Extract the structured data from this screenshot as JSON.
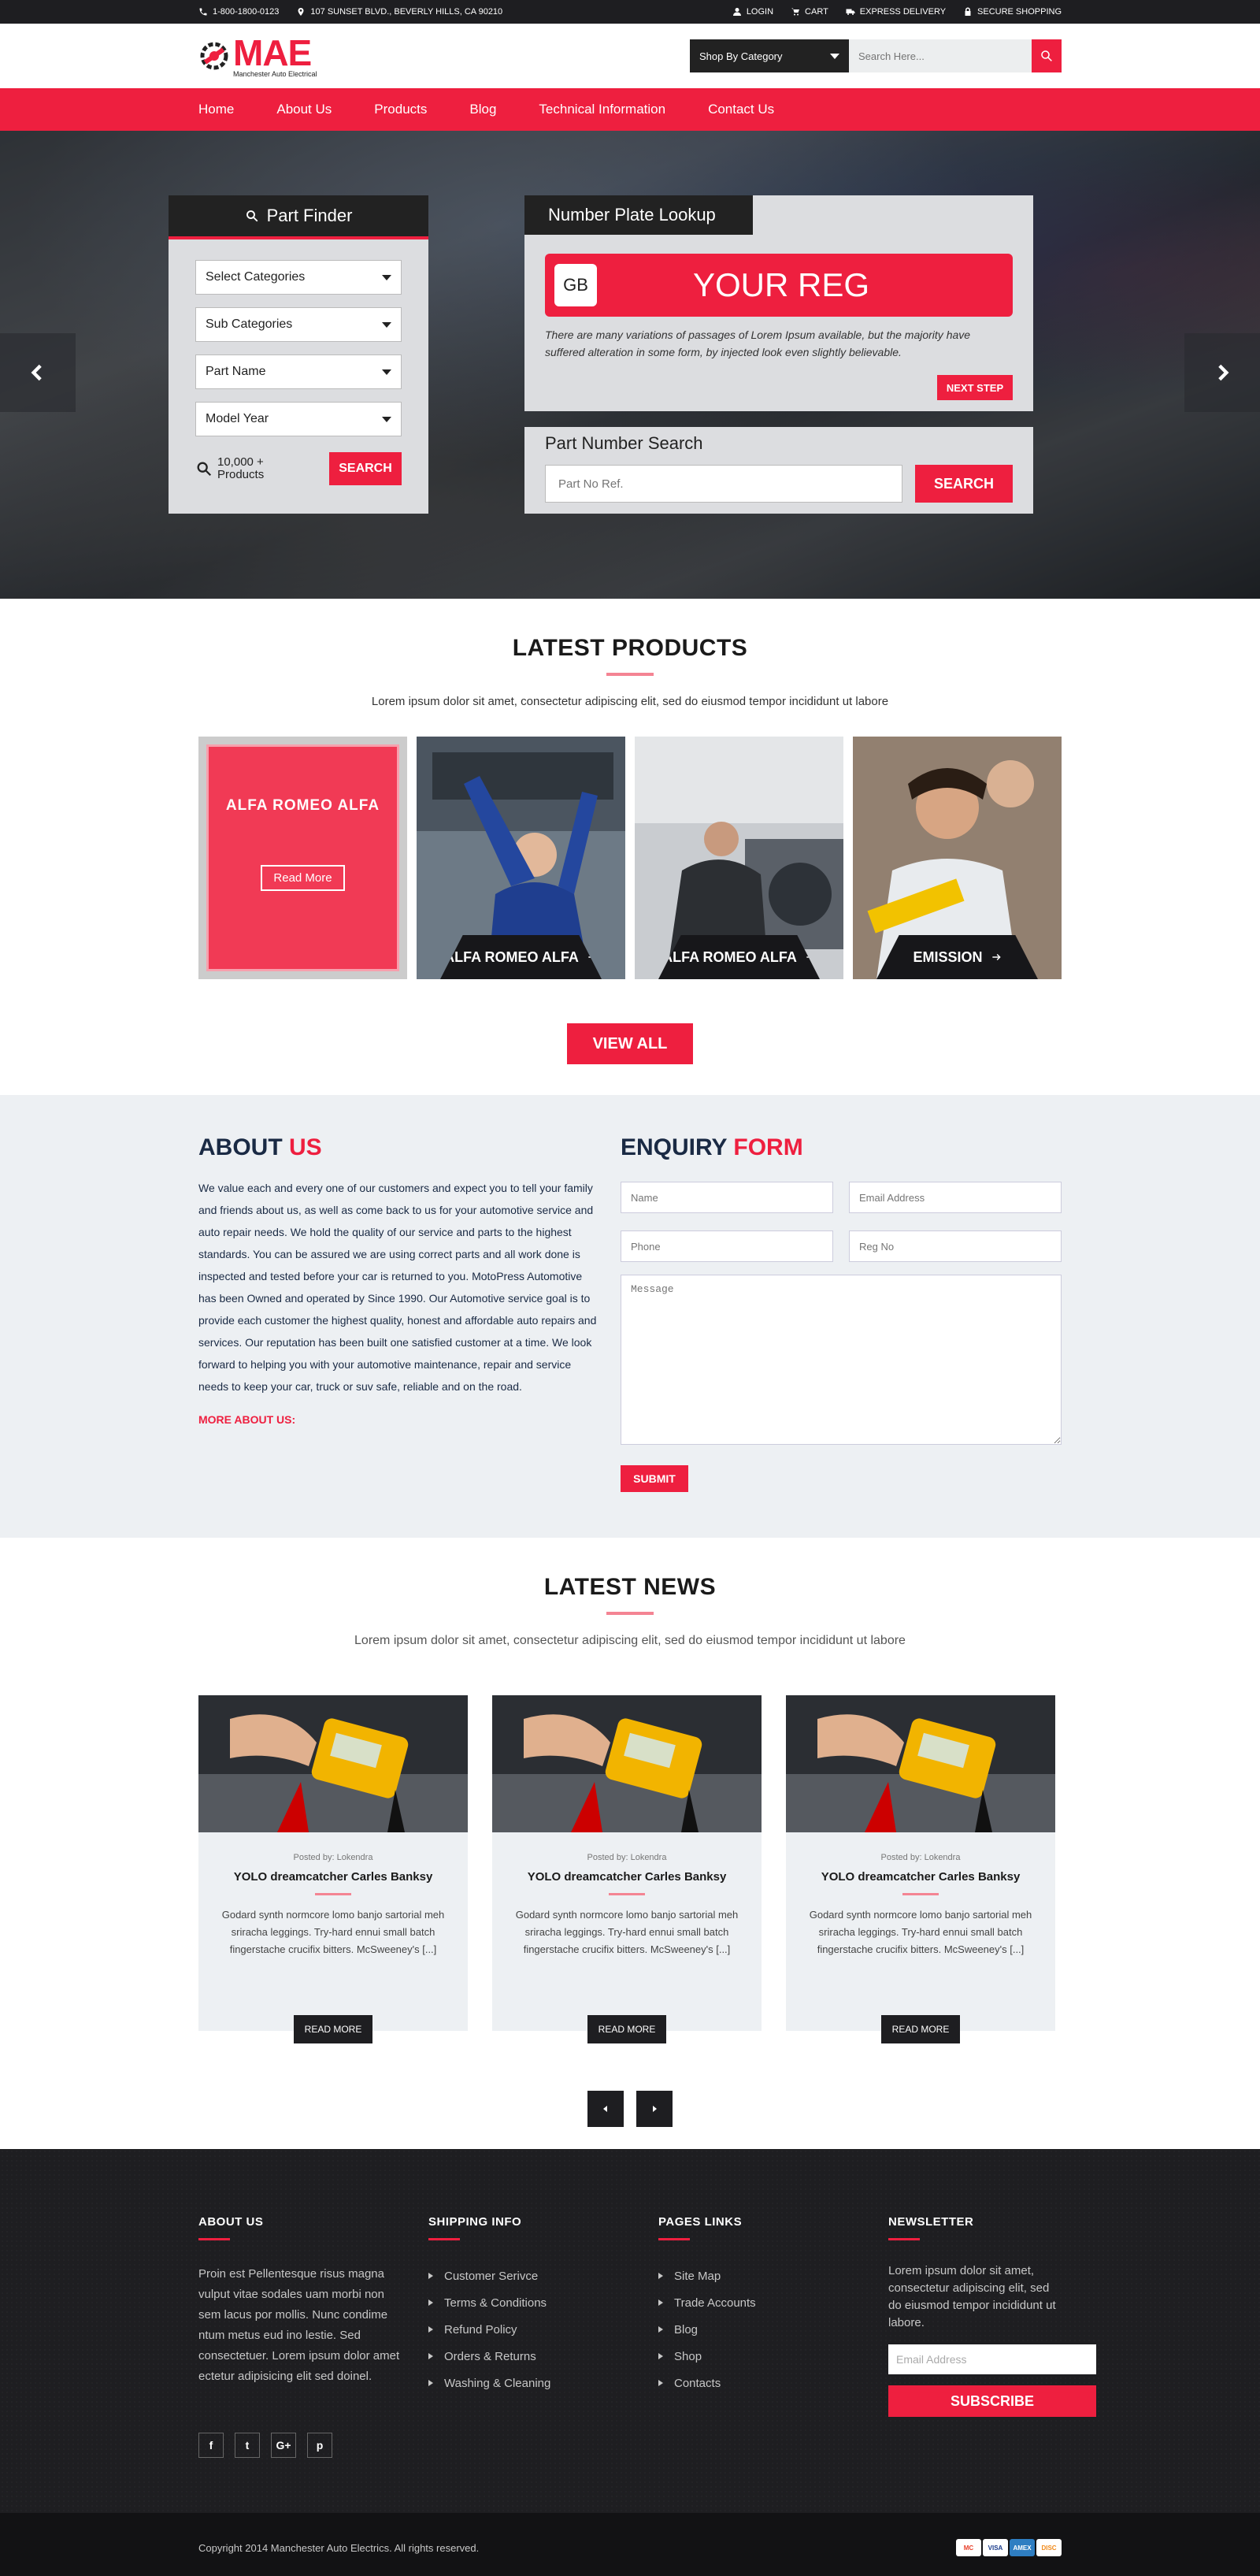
{
  "topbar": {
    "phone": "1-800-1800-0123",
    "address": "107 SUNSET BLVD., BEVERLY HILLS, CA 90210",
    "login": "LOGIN",
    "cart": "CART",
    "delivery": "EXPRESS DELIVERY",
    "secure": "SECURE SHOPPING"
  },
  "header": {
    "logo_main": "MAE",
    "logo_sub": "Manchester Auto Electrical",
    "category_select": "Shop By Category",
    "search_placeholder": "Search Here..."
  },
  "nav": [
    "Home",
    "About Us",
    "Products",
    "Blog",
    "Technical Information",
    "Contact Us"
  ],
  "part_finder": {
    "title": "Part Finder",
    "selects": [
      "Select Categories",
      "Sub Categories",
      "Part Name",
      "Model Year"
    ],
    "count": "10,000 +",
    "count_label": "Products",
    "button": "SEARCH"
  },
  "plate_lookup": {
    "title": "Number Plate Lookup",
    "country": "GB",
    "reg": "YOUR REG",
    "desc": "There are many variations of passages of Lorem Ipsum available, but the majority have suffered alteration in some form, by injected look even slightly believable.",
    "button": "NEXT STEP"
  },
  "part_number": {
    "title": "Part Number Search",
    "placeholder": "Part No Ref.",
    "button": "SEARCH"
  },
  "latest_products": {
    "title": "LATEST PRODUCTS",
    "subtitle": "Lorem ipsum dolor sit amet, consectetur adipiscing elit, sed do eiusmod tempor incididunt ut labore",
    "featured": {
      "title": "ALFA ROMEO ALFA",
      "button": "Read More"
    },
    "items": [
      "ALFA ROMEO ALFA",
      "ALFA ROMEO ALFA",
      "EMISSION"
    ],
    "view_all": "VIEW ALL"
  },
  "about": {
    "title_a": "ABOUT",
    "title_b": "US",
    "text": "We value each and every one of our customers and expect you to tell your family and friends about us, as well as come back to us for your automotive service and auto repair needs. We hold the quality of our service and parts to the highest standards. You can be assured we are using correct parts and all work done is inspected and tested before your car is returned to you. MotoPress Automotive has been Owned and operated by Since 1990. Our Automotive service goal is to provide each customer the highest quality, honest and affordable auto repairs and services. Our reputation has been built one satisfied customer at a time. We look forward to helping you with your automotive maintenance, repair and service needs to keep your car, truck or suv safe, reliable and on the road.",
    "more": "MORE ABOUT US:"
  },
  "enquiry": {
    "title_a": "ENQUIRY",
    "title_b": "FORM",
    "name": "Name",
    "email": "Email Address",
    "phone": "Phone",
    "reg": "Reg No",
    "message": "Message",
    "submit": "SUBMIT"
  },
  "news": {
    "title": "LATEST NEWS",
    "subtitle": "Lorem ipsum dolor sit amet, consectetur adipiscing elit, sed do eiusmod tempor incididunt ut labore",
    "cards": [
      {
        "meta": "Posted by: Lokendra",
        "title": "YOLO dreamcatcher Carles Banksy",
        "text": "Godard synth normcore lomo banjo sartorial meh sriracha leggings. Try-hard ennui small batch fingerstache crucifix bitters. McSweeney's [...]",
        "button": "READ MORE"
      },
      {
        "meta": "Posted by: Lokendra",
        "title": "YOLO dreamcatcher Carles Banksy",
        "text": "Godard synth normcore lomo banjo sartorial meh sriracha leggings. Try-hard ennui small batch fingerstache crucifix bitters. McSweeney's [...]",
        "button": "READ MORE"
      },
      {
        "meta": "Posted by: Lokendra",
        "title": "YOLO dreamcatcher Carles Banksy",
        "text": "Godard synth normcore lomo banjo sartorial meh sriracha leggings. Try-hard ennui small batch fingerstache crucifix bitters. McSweeney's [...]",
        "button": "READ MORE"
      }
    ]
  },
  "footer": {
    "about_title": "ABOUT US",
    "about_text": "Proin est Pellentesque risus magna vulput vitae sodales uam morbi non sem lacus por mollis. Nunc condime ntum metus eud ino lestie. Sed consectetuer. Lorem ipsum dolor amet ectetur adipisicing elit sed doinel.",
    "social": [
      "f",
      "t",
      "G+",
      "p"
    ],
    "shipping_title": "SHIPPING INFO",
    "shipping": [
      "Customer Serivce",
      "Terms & Conditions",
      "Refund Policy",
      "Orders & Returns",
      "Washing & Cleaning"
    ],
    "pages_title": "PAGES LINKS",
    "pages": [
      "Site Map",
      "Trade Accounts",
      "Blog",
      "Shop",
      "Contacts"
    ],
    "newsletter_title": "NEWSLETTER",
    "newsletter_text": "Lorem ipsum dolor sit amet, consectetur adipiscing elit, sed do eiusmod tempor incididunt ut labore.",
    "newsletter_placeholder": "Email Address",
    "subscribe": "SUBSCRIBE",
    "copyright": "Copyright 2014 Manchester Auto Electrics. All rights reserved.",
    "payment": [
      "MC",
      "VISA",
      "AMEX",
      "DISC"
    ]
  },
  "colors": {
    "accent": "#ee1f3f",
    "dark": "#1e1e21",
    "light_panel": "#edf0f3"
  }
}
